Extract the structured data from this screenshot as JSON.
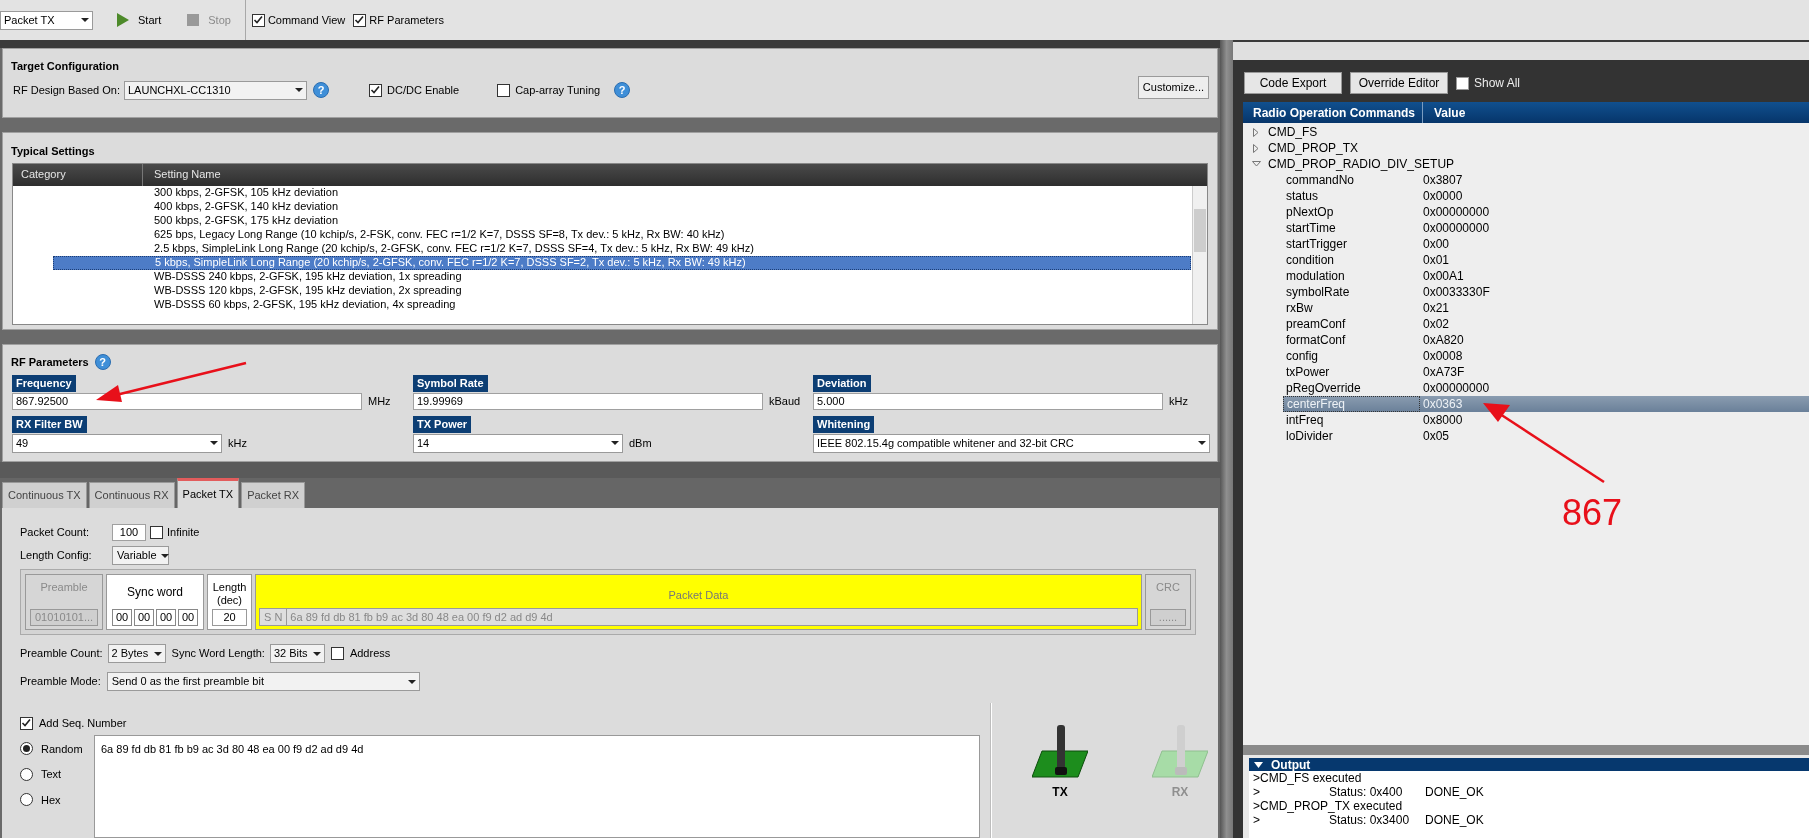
{
  "toolbar": {
    "mode": "Packet TX",
    "start": {
      "label": "Start",
      "disabled": false
    },
    "stop": {
      "label": "Stop",
      "disabled": true
    },
    "checkboxes": [
      {
        "label": "Command View",
        "checked": true
      },
      {
        "label": "RF Parameters",
        "checked": true
      }
    ]
  },
  "target_configuration": {
    "title": "Target Configuration",
    "rf_design_label": "RF Design Based On:",
    "rf_design": "LAUNCHXL-CC1310",
    "help": "?",
    "options": [
      {
        "label": "DC/DC Enable",
        "checked": true
      },
      {
        "label": "Cap-array Tuning",
        "checked": false,
        "help": "?"
      }
    ],
    "customize": "Customize..."
  },
  "typical_settings": {
    "title": "Typical Settings",
    "columns": [
      "Category",
      "Setting Name"
    ],
    "rows": [
      {
        "name": "300 kbps, 2-GFSK, 105 kHz deviation",
        "selected": false
      },
      {
        "name": "400 kbps, 2-GFSK, 140 kHz deviation",
        "selected": false
      },
      {
        "name": "500 kbps, 2-GFSK, 175 kHz deviation",
        "selected": false
      },
      {
        "name": "625 bps, Legacy Long Range (10 kchip/s, 2-FSK, conv. FEC r=1/2 K=7, DSSS SF=8, Tx dev.: 5 kHz, Rx BW: 40 kHz)",
        "selected": false
      },
      {
        "name": "2.5 kbps, SimpleLink Long Range (20 kchip/s, 2-GFSK, conv. FEC r=1/2 K=7, DSSS SF=4, Tx dev.: 5 kHz, Rx BW: 49 kHz)",
        "selected": false
      },
      {
        "name": "5 kbps, SimpleLink Long Range (20 kchip/s, 2-GFSK, conv. FEC r=1/2 K=7, DSSS SF=2, Tx dev.: 5 kHz, Rx BW: 49 kHz)",
        "selected": true
      },
      {
        "name": "WB-DSSS 240 kbps, 2-GFSK, 195 kHz deviation, 1x spreading",
        "selected": false
      },
      {
        "name": "WB-DSSS 120 kbps, 2-GFSK, 195 kHz deviation, 2x spreading",
        "selected": false
      },
      {
        "name": "WB-DSSS 60 kbps, 2-GFSK, 195 kHz deviation, 4x spreading",
        "selected": false
      }
    ]
  },
  "rf_parameters": {
    "title": "RF Parameters",
    "help": "?",
    "fields": [
      {
        "label": "Frequency",
        "kind": "input",
        "value": "867.92500",
        "unit": "MHz"
      },
      {
        "label": "Symbol Rate",
        "kind": "input",
        "value": "19.99969",
        "unit": "kBaud"
      },
      {
        "label": "Deviation",
        "kind": "input",
        "value": "5.000",
        "unit": "kHz"
      },
      {
        "label": "RX Filter BW",
        "kind": "select",
        "value": "49",
        "unit": "kHz"
      },
      {
        "label": "TX Power",
        "kind": "select",
        "value": "14",
        "unit": "dBm"
      },
      {
        "label": "Whitening",
        "kind": "select",
        "value": "IEEE 802.15.4g compatible whitener and 32-bit CRC"
      }
    ]
  },
  "tabs": [
    {
      "label": "Continuous TX",
      "selected": false
    },
    {
      "label": "Continuous RX",
      "selected": false
    },
    {
      "label": "Packet TX",
      "selected": true
    },
    {
      "label": "Packet RX",
      "selected": false
    }
  ],
  "packet_tx": {
    "packet_count_label": "Packet Count:",
    "packet_count": "100",
    "infinite": {
      "label": "Infinite",
      "checked": false
    },
    "length_config_label": "Length Config:",
    "length_config": "Variable",
    "structure": [
      {
        "kind": "field",
        "label": "Preamble",
        "value": "01010101...",
        "disabled": true
      },
      {
        "kind": "bytes",
        "label": "Sync word",
        "bytes": [
          "00",
          "00",
          "00",
          "00"
        ]
      },
      {
        "kind": "field",
        "label": "Length (dec)",
        "value": "20",
        "disabled": false
      },
      {
        "kind": "data",
        "label": "Packet Data",
        "prefix": "S N",
        "value": "6a 89 fd db 81 fb b9 ac 3d 80 48 ea 00 f9 d2 ad d9 4d"
      },
      {
        "kind": "field",
        "label": "CRC",
        "value": "......",
        "disabled": true
      }
    ],
    "preamble_count_label": "Preamble Count:",
    "preamble_count": "2 Bytes",
    "sync_word_length_label": "Sync Word Length:",
    "sync_word_length": "32 Bits",
    "address": {
      "label": "Address",
      "checked": false
    },
    "preamble_mode_label": "Preamble Mode:",
    "preamble_mode": "Send 0 as the first preamble bit",
    "add_seq_number": {
      "label": "Add Seq. Number",
      "checked": true
    },
    "payload_types": [
      {
        "label": "Random",
        "selected": true
      },
      {
        "label": "Text",
        "selected": false
      },
      {
        "label": "Hex",
        "selected": false
      }
    ],
    "payload": "6a 89 fd db 81 fb b9 ac 3d 80 48 ea 00 f9 d2 ad d9 4d",
    "radios": [
      {
        "label": "TX",
        "active": true
      },
      {
        "label": "RX",
        "active": false
      }
    ]
  },
  "command_view": {
    "buttons": [
      "Code Export",
      "Override Editor"
    ],
    "show_all": {
      "label": "Show All",
      "checked": false
    },
    "columns": [
      "Radio Operation Commands",
      "Value"
    ],
    "commands": [
      {
        "name": "CMD_FS",
        "expanded": false,
        "selected": false
      },
      {
        "name": "CMD_PROP_TX",
        "expanded": false,
        "selected": false
      },
      {
        "name": "CMD_PROP_RADIO_DIV_SETUP",
        "expanded": true,
        "selected": false,
        "children": [
          {
            "name": "commandNo",
            "value": "0x3807",
            "selected": false
          },
          {
            "name": "status",
            "value": "0x0000",
            "selected": false
          },
          {
            "name": "pNextOp",
            "value": "0x00000000",
            "selected": false
          },
          {
            "name": "startTime",
            "value": "0x00000000",
            "selected": false
          },
          {
            "name": "startTrigger",
            "value": "0x00",
            "selected": false
          },
          {
            "name": "condition",
            "value": "0x01",
            "selected": false
          },
          {
            "name": "modulation",
            "value": "0x00A1",
            "selected": false
          },
          {
            "name": "symbolRate",
            "value": "0x0033330F",
            "selected": false
          },
          {
            "name": "rxBw",
            "value": "0x21",
            "selected": false
          },
          {
            "name": "preamConf",
            "value": "0x02",
            "selected": false
          },
          {
            "name": "formatConf",
            "value": "0xA820",
            "selected": false
          },
          {
            "name": "config",
            "value": "0x0008",
            "selected": false
          },
          {
            "name": "txPower",
            "value": "0xA73F",
            "selected": false
          },
          {
            "name": "pRegOverride",
            "value": "0x00000000",
            "selected": false
          },
          {
            "name": "centerFreq",
            "value": "0x0363",
            "selected": true
          },
          {
            "name": "intFreq",
            "value": "0x8000",
            "selected": false
          },
          {
            "name": "loDivider",
            "value": "0x05",
            "selected": false
          }
        ]
      }
    ]
  },
  "output": {
    "title": "Output",
    "expanded": true,
    "lines": [
      {
        "kind": "message",
        "text": ">CMD_FS executed"
      },
      {
        "kind": "status",
        "prompt": ">",
        "status": "Status: 0x400",
        "result": "DONE_OK"
      },
      {
        "kind": "message",
        "text": ">CMD_PROP_TX executed"
      },
      {
        "kind": "status",
        "prompt": ">",
        "status": "Status: 0x3400",
        "result": "DONE_OK"
      }
    ]
  },
  "annotation": {
    "text": "867"
  }
}
